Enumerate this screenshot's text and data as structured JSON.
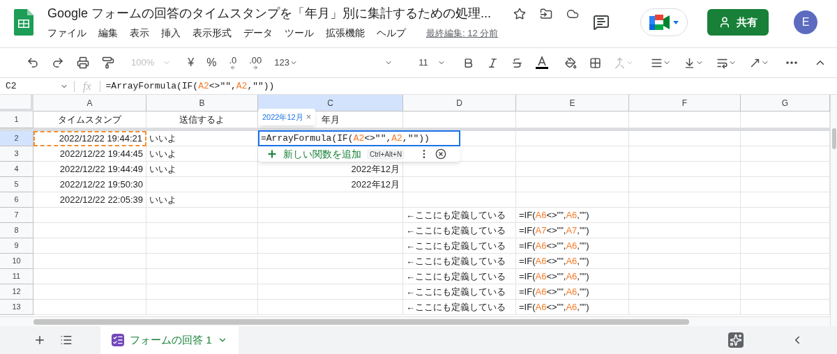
{
  "document": {
    "title": "Google フォームの回答のタイムスタンプを「年月」別に集計するための処理..."
  },
  "menu": [
    "ファイル",
    "編集",
    "表示",
    "挿入",
    "表示形式",
    "データ",
    "ツール",
    "拡張機能",
    "ヘルプ"
  ],
  "last_edit": "最終編集: 12 分前",
  "share_button": "共有",
  "avatar": "E",
  "toolbar": {
    "zoom": {
      "label": "100%",
      "disabled": true
    },
    "currency": "¥",
    "percent": "%",
    "decimal_less": ".0",
    "decimal_more": ".00",
    "number_format": "123",
    "font_size": "11",
    "merge": {
      "disabled": true
    }
  },
  "formula_bar": {
    "name_box": "C2",
    "fx": "fx",
    "parts": [
      {
        "kind": "plain",
        "text": "=ArrayFormula(IF("
      },
      {
        "kind": "ref",
        "text": "A2"
      },
      {
        "kind": "plain",
        "text": "<>\"\","
      },
      {
        "kind": "ref",
        "text": "A2"
      },
      {
        "kind": "plain",
        "text": ",\"\"))"
      }
    ]
  },
  "columns": [
    {
      "label": "A",
      "selected": false
    },
    {
      "label": "B",
      "selected": false
    },
    {
      "label": "C",
      "selected": true
    },
    {
      "label": "D",
      "selected": false
    },
    {
      "label": "E",
      "selected": false
    },
    {
      "label": "F",
      "selected": false
    },
    {
      "label": "G",
      "selected": false
    }
  ],
  "rows": [
    {
      "number": "1",
      "selected": false,
      "cells": [
        {
          "kind": "center",
          "text": "タイムスタンプ"
        },
        {
          "kind": "center",
          "text": "送信するよ"
        },
        {
          "kind": "center",
          "text": "年月"
        }
      ]
    },
    {
      "number": "2",
      "selected": true,
      "cells": [
        {
          "kind": "number",
          "text": "2022/12/22 19:44:21",
          "copied": true
        },
        {
          "kind": "text",
          "text": "いいよ"
        },
        null
      ]
    },
    {
      "number": "3",
      "selected": false,
      "cells": [
        {
          "kind": "number",
          "text": "2022/12/22 19:44:45"
        },
        {
          "kind": "text",
          "text": "いいよ"
        },
        null
      ]
    },
    {
      "number": "4",
      "selected": false,
      "cells": [
        {
          "kind": "number",
          "text": "2022/12/22 19:44:49"
        },
        {
          "kind": "text",
          "text": "いいよ"
        },
        {
          "kind": "number",
          "text": "2022年12月"
        }
      ]
    },
    {
      "number": "5",
      "selected": false,
      "cells": [
        {
          "kind": "number",
          "text": "2022/12/22 19:50:30"
        },
        null,
        {
          "kind": "number",
          "text": "2022年12月"
        }
      ]
    },
    {
      "number": "6",
      "selected": false,
      "cells": [
        {
          "kind": "number",
          "text": "2022/12/22 22:05:39"
        },
        {
          "kind": "text",
          "text": "いいよ"
        },
        null
      ]
    },
    {
      "number": "7",
      "selected": false,
      "cells": [
        null,
        null,
        null,
        {
          "kind": "text",
          "text": "←ここにも定義している"
        },
        {
          "kind": "formula",
          "parts": [
            {
              "kind": "plain",
              "text": "=IF("
            },
            {
              "kind": "ref",
              "text": "A6"
            },
            {
              "kind": "plain",
              "text": "<>\"\","
            },
            {
              "kind": "ref",
              "text": "A6"
            },
            {
              "kind": "plain",
              "text": ",\"\")"
            }
          ]
        }
      ]
    },
    {
      "number": "8",
      "selected": false,
      "cells": [
        null,
        null,
        null,
        {
          "kind": "text",
          "text": "←ここにも定義している"
        },
        {
          "kind": "formula",
          "parts": [
            {
              "kind": "plain",
              "text": "=IF("
            },
            {
              "kind": "ref",
              "text": "A7"
            },
            {
              "kind": "plain",
              "text": "<>\"\","
            },
            {
              "kind": "ref",
              "text": "A7"
            },
            {
              "kind": "plain",
              "text": ",\"\")"
            }
          ]
        }
      ]
    },
    {
      "number": "9",
      "selected": false,
      "cells": [
        null,
        null,
        null,
        {
          "kind": "text",
          "text": "←ここにも定義している"
        },
        {
          "kind": "formula",
          "parts": [
            {
              "kind": "plain",
              "text": "=IF("
            },
            {
              "kind": "ref",
              "text": "A6"
            },
            {
              "kind": "plain",
              "text": "<>\"\","
            },
            {
              "kind": "ref",
              "text": "A6"
            },
            {
              "kind": "plain",
              "text": ",\"\")"
            }
          ]
        }
      ]
    },
    {
      "number": "10",
      "selected": false,
      "cells": [
        null,
        null,
        null,
        {
          "kind": "text",
          "text": "←ここにも定義している"
        },
        {
          "kind": "formula",
          "parts": [
            {
              "kind": "plain",
              "text": "=IF("
            },
            {
              "kind": "ref",
              "text": "A6"
            },
            {
              "kind": "plain",
              "text": "<>\"\","
            },
            {
              "kind": "ref",
              "text": "A6"
            },
            {
              "kind": "plain",
              "text": ",\"\")"
            }
          ]
        }
      ]
    },
    {
      "number": "11",
      "selected": false,
      "cells": [
        null,
        null,
        null,
        {
          "kind": "text",
          "text": "←ここにも定義している"
        },
        {
          "kind": "formula",
          "parts": [
            {
              "kind": "plain",
              "text": "=IF("
            },
            {
              "kind": "ref",
              "text": "A6"
            },
            {
              "kind": "plain",
              "text": "<>\"\","
            },
            {
              "kind": "ref",
              "text": "A6"
            },
            {
              "kind": "plain",
              "text": ",\"\")"
            }
          ]
        }
      ]
    },
    {
      "number": "12",
      "selected": false,
      "cells": [
        null,
        null,
        null,
        {
          "kind": "text",
          "text": "←ここにも定義している"
        },
        {
          "kind": "formula",
          "parts": [
            {
              "kind": "plain",
              "text": "=IF("
            },
            {
              "kind": "ref",
              "text": "A6"
            },
            {
              "kind": "plain",
              "text": "<>\"\","
            },
            {
              "kind": "ref",
              "text": "A6"
            },
            {
              "kind": "plain",
              "text": ",\"\")"
            }
          ]
        }
      ]
    },
    {
      "number": "13",
      "selected": false,
      "cells": [
        null,
        null,
        null,
        {
          "kind": "text",
          "text": "←ここにも定義している"
        },
        {
          "kind": "formula",
          "parts": [
            {
              "kind": "plain",
              "text": "=IF("
            },
            {
              "kind": "ref",
              "text": "A6"
            },
            {
              "kind": "plain",
              "text": "<>\"\","
            },
            {
              "kind": "ref",
              "text": "A6"
            },
            {
              "kind": "plain",
              "text": ",\"\")"
            }
          ]
        }
      ]
    }
  ],
  "editor": {
    "parts": [
      {
        "kind": "plain",
        "text": "=ArrayFormula(IF("
      },
      {
        "kind": "ref",
        "text": "A2"
      },
      {
        "kind": "plain",
        "text": "<>\"\","
      },
      {
        "kind": "ref",
        "text": "A2"
      },
      {
        "kind": "plain",
        "text": ",\"\"))"
      }
    ]
  },
  "value_hint": {
    "text": "2022年12月",
    "close": "×"
  },
  "suggestion": {
    "label": "新しい関数を追加",
    "shortcut": "Ctrl+Alt+N"
  },
  "sheets": [
    {
      "name": "フォームの回答 1",
      "selected": true
    }
  ]
}
